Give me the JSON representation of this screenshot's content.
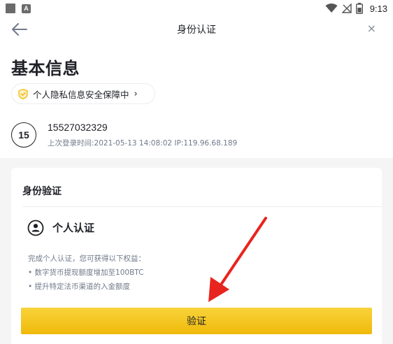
{
  "status_bar": {
    "time": "9:13",
    "icons": [
      "square-icon",
      "a-icon",
      "wifi-icon",
      "no-signal-icon",
      "battery-icon"
    ]
  },
  "nav": {
    "title": "身份认证",
    "back_icon": "arrow-left-icon",
    "close_label": "×"
  },
  "page_title": "基本信息",
  "privacy": {
    "label": "个人隐私信息安全保障中",
    "chevron": "›",
    "icon": "shield-check-icon",
    "icon_color": "#f0b90b"
  },
  "user": {
    "avatar_text": "15",
    "phone": "15527032329",
    "last_login": "上次登录时间:2021-05-13 14:08:02  IP:119.96.68.189"
  },
  "card": {
    "title": "身份验证",
    "personal_title": "个人认证",
    "personal_icon": "user-circle-icon",
    "benefits": [
      "完成个人认证，您可获得以下权益：",
      "• 数字货币提现额度增加至100BTC",
      "• 提升特定法币渠道的入金额度"
    ],
    "verify_label": "验证"
  },
  "annotation": {
    "icon": "red-arrow-icon",
    "color": "#e8241e"
  },
  "colors": {
    "accent": "#f0b90b",
    "text_primary": "#1e2026",
    "text_secondary": "#707a8a",
    "background_lower": "#f5f5f5"
  }
}
